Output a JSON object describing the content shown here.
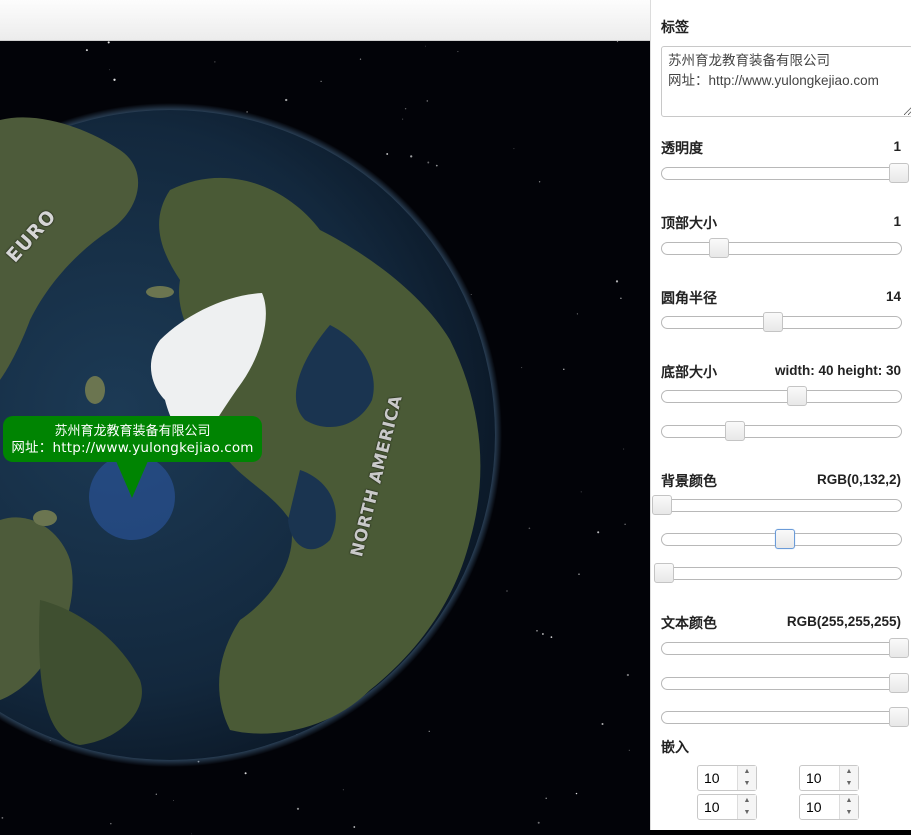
{
  "map": {
    "bubble": {
      "line1": "苏州育龙教育装备有限公司",
      "line2": "网址：http://www.yulongkejiao.com",
      "background": "#008402",
      "text_color": "#ffffff"
    },
    "labels": {
      "north_america": "NORTH AMERICA",
      "europe": "EURO"
    }
  },
  "panel": {
    "title": "标签",
    "label_text": "苏州育龙教育装备有限公司\n网址：http://www.yulongkejiao.com",
    "opacity": {
      "label": "透明度",
      "value": "1",
      "level": 1.0
    },
    "top_size": {
      "label": "顶部大小",
      "value": "1",
      "level": 0.24
    },
    "corner_radius": {
      "label": "圆角半径",
      "value": "14",
      "level": 0.47
    },
    "bottom_size": {
      "label": "底部大小",
      "value": "width: 40 height: 30",
      "width_level": 0.57,
      "height_level": 0.31
    },
    "background_color": {
      "label": "背景颜色",
      "value": "RGB(0,132,2)",
      "r": 0,
      "g": 132,
      "b": 2
    },
    "text_color": {
      "label": "文本颜色",
      "value": "RGB(255,255,255)",
      "r": 255,
      "g": 255,
      "b": 255
    },
    "padding": {
      "label": "嵌入",
      "values": [
        "10",
        "10",
        "10",
        "10"
      ]
    }
  }
}
